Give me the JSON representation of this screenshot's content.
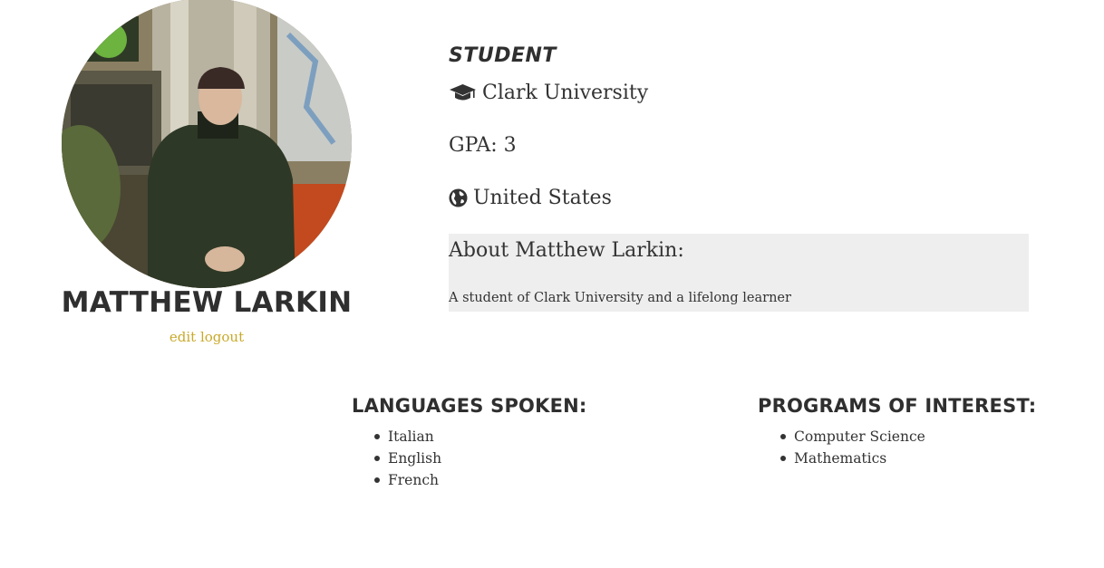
{
  "profile": {
    "name": "MATTHEW LARKIN",
    "avatar_alt": "profile photo",
    "links": {
      "edit": "edit",
      "logout": "logout"
    }
  },
  "details": {
    "role": "STUDENT",
    "university": "Clark University",
    "university_icon": "graduation-cap-icon",
    "gpa": "GPA: 3",
    "country": "United States",
    "country_icon": "globe-icon"
  },
  "about": {
    "title": "About Matthew Larkin:",
    "text": "A student of Clark University and a lifelong learner"
  },
  "languages": {
    "title": "LANGUAGES SPOKEN:",
    "items": [
      "Italian",
      "English",
      "French"
    ]
  },
  "programs": {
    "title": "PROGRAMS OF INTEREST:",
    "items": [
      "Computer Science",
      "Mathematics"
    ]
  },
  "colors": {
    "link": "#c9a92a",
    "about_background": "#eeeeee",
    "text": "#333333"
  }
}
